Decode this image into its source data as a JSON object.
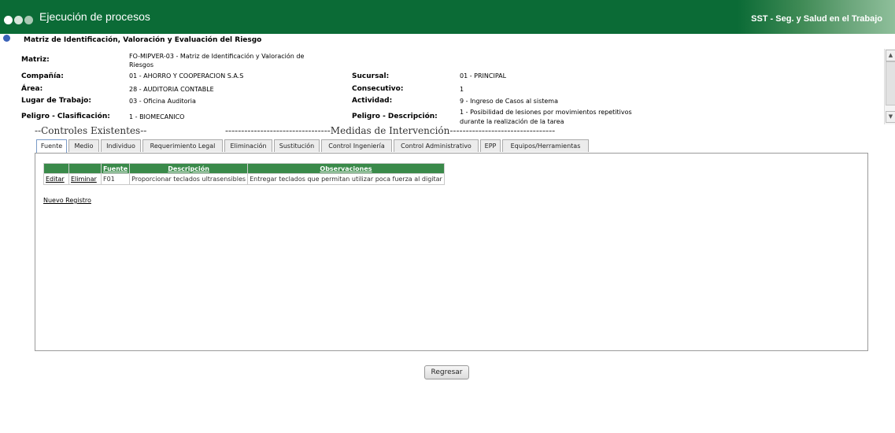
{
  "header": {
    "app_title": "Ejecución de procesos",
    "brand": "SST - Seg. y Salud en el Trabajo"
  },
  "page": {
    "title": "Matriz de Identificación, Valoración y Evaluación del Riesgo"
  },
  "fields": {
    "matriz": {
      "label": "Matriz:",
      "value_line1": "FO-MIPVER-03 - Matriz de Identificación y Valoración de",
      "value_line2": "Riesgos"
    },
    "compania": {
      "label": "Compañía:",
      "value": "01 - AHORRO Y COOPERACION S.A.S"
    },
    "sucursal": {
      "label": "Sucursal:",
      "value": "01 - PRINCIPAL"
    },
    "area": {
      "label": "Área:",
      "value": "28 - AUDITORIA CONTABLE"
    },
    "consecutivo": {
      "label": "Consecutivo:",
      "value": "1"
    },
    "lugar": {
      "label": "Lugar de Trabajo:",
      "value": "03 - Oficina Auditoria"
    },
    "actividad": {
      "label": "Actividad:",
      "value": "9 - Ingreso de Casos al sistema"
    },
    "peligro_clas": {
      "label": "Peligro - Clasificación:",
      "value": "1 - BIOMECANICO"
    },
    "peligro_desc": {
      "label": "Peligro - Descripción:",
      "value_line1": "1 - Posibilidad de lesiones por movimientos repetitivos",
      "value_line2": "durante la realización de la tarea"
    }
  },
  "sections": {
    "controles": "--Controles Existentes--",
    "medidas": "---------------------------------Medidas de Intervención---------------------------------"
  },
  "tabs": [
    "Fuente",
    "Medio",
    "Individuo",
    "Requerimiento Legal",
    "Eliminación",
    "Sustitución",
    "Control Ingeniería",
    "Control Administrativo",
    "EPP",
    "Equipos/Herramientas"
  ],
  "table": {
    "headers": [
      "",
      "",
      "Fuente",
      "Descripción",
      "Observaciones"
    ],
    "rows": [
      {
        "edit": "Editar",
        "delete": "Eliminar",
        "fuente": "F01",
        "descripcion": "Proporcionar teclados ultrasensibles",
        "observaciones": "Entregar teclados que permitan utilizar poca fuerza al digitar"
      }
    ]
  },
  "new_record": "Nuevo Registro",
  "back_button": "Regresar"
}
